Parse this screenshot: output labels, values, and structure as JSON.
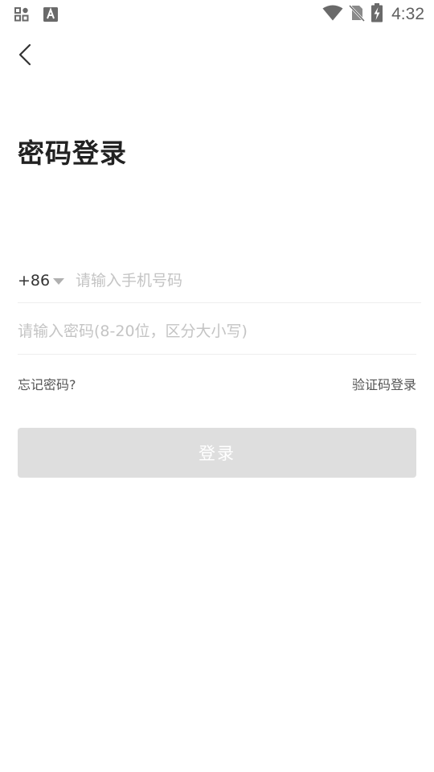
{
  "status_bar": {
    "time": "4:32",
    "left_icons": [
      "apps-grid-icon",
      "text-a-icon"
    ],
    "right_icons": [
      "wifi-icon",
      "no-sim-icon",
      "battery-charging-icon"
    ]
  },
  "header": {
    "back_icon": "chevron-left-icon",
    "title": "密码登录"
  },
  "form": {
    "country_code": "+86",
    "phone": {
      "value": "",
      "placeholder": "请输入手机号码"
    },
    "password": {
      "value": "",
      "placeholder": "请输入密码(8-20位，区分大小写)"
    },
    "forgot_password_label": "忘记密码?",
    "code_login_label": "验证码登录",
    "submit_label": "登录"
  },
  "colors": {
    "title": "#222222",
    "placeholder": "#c4c4c4",
    "link": "#555555",
    "button_disabled_bg": "#dedede",
    "button_text": "#ffffff",
    "divider": "#eeeeee"
  }
}
